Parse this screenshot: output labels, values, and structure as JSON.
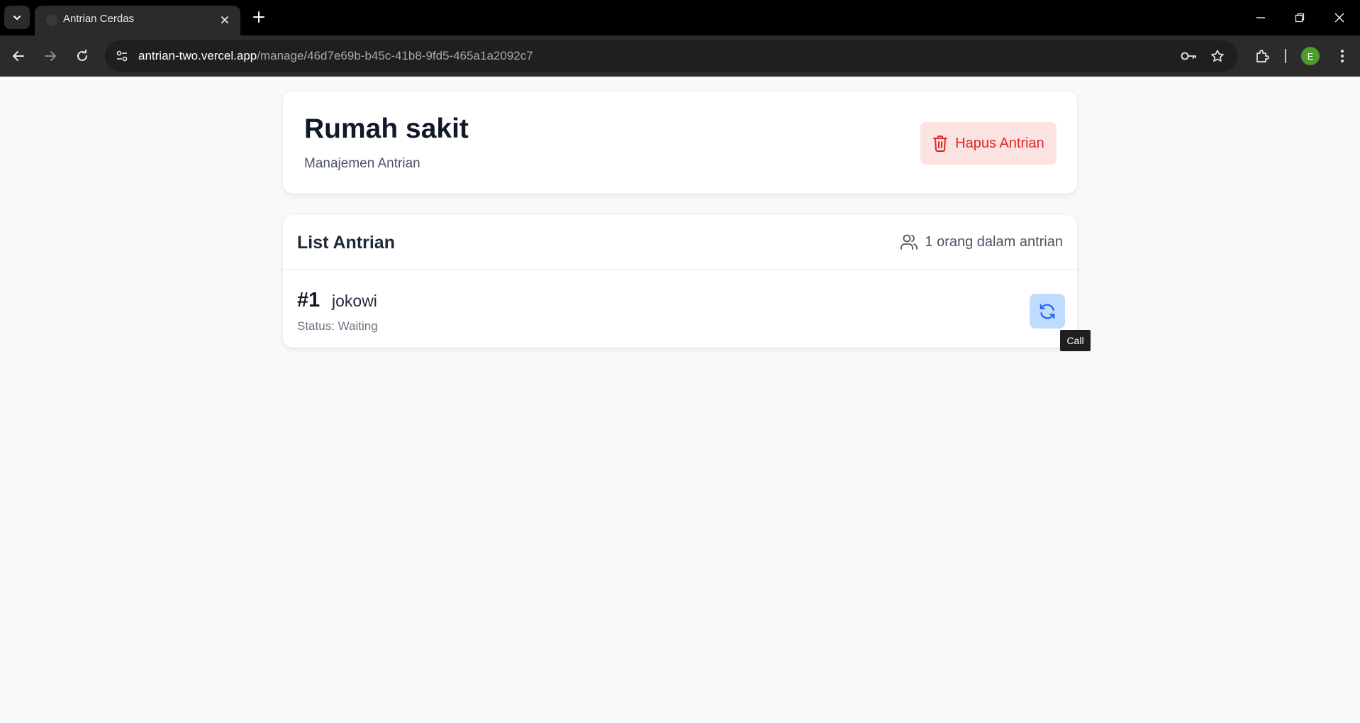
{
  "browser": {
    "tab_title": "Antrian Cerdas",
    "url_host": "antrian-two.vercel.app",
    "url_path": "/manage/46d7e69b-b45c-41b8-9fd5-465a1a2092c7",
    "profile_initial": "E"
  },
  "header": {
    "title": "Rumah sakit",
    "subtitle": "Manajemen Antrian",
    "delete_label": "Hapus Antrian"
  },
  "queue": {
    "title": "List Antrian",
    "count_text": "1 orang dalam antrian",
    "items": [
      {
        "number": "#1",
        "name": "jokowi",
        "status": "Status: Waiting"
      }
    ]
  },
  "tooltip": {
    "text": "Call"
  },
  "colors": {
    "delete_bg": "#fde2e2",
    "delete_fg": "#dc2626",
    "call_bg": "#bfdbfe",
    "call_fg": "#2563eb",
    "page_bg": "#f8f9fb"
  }
}
